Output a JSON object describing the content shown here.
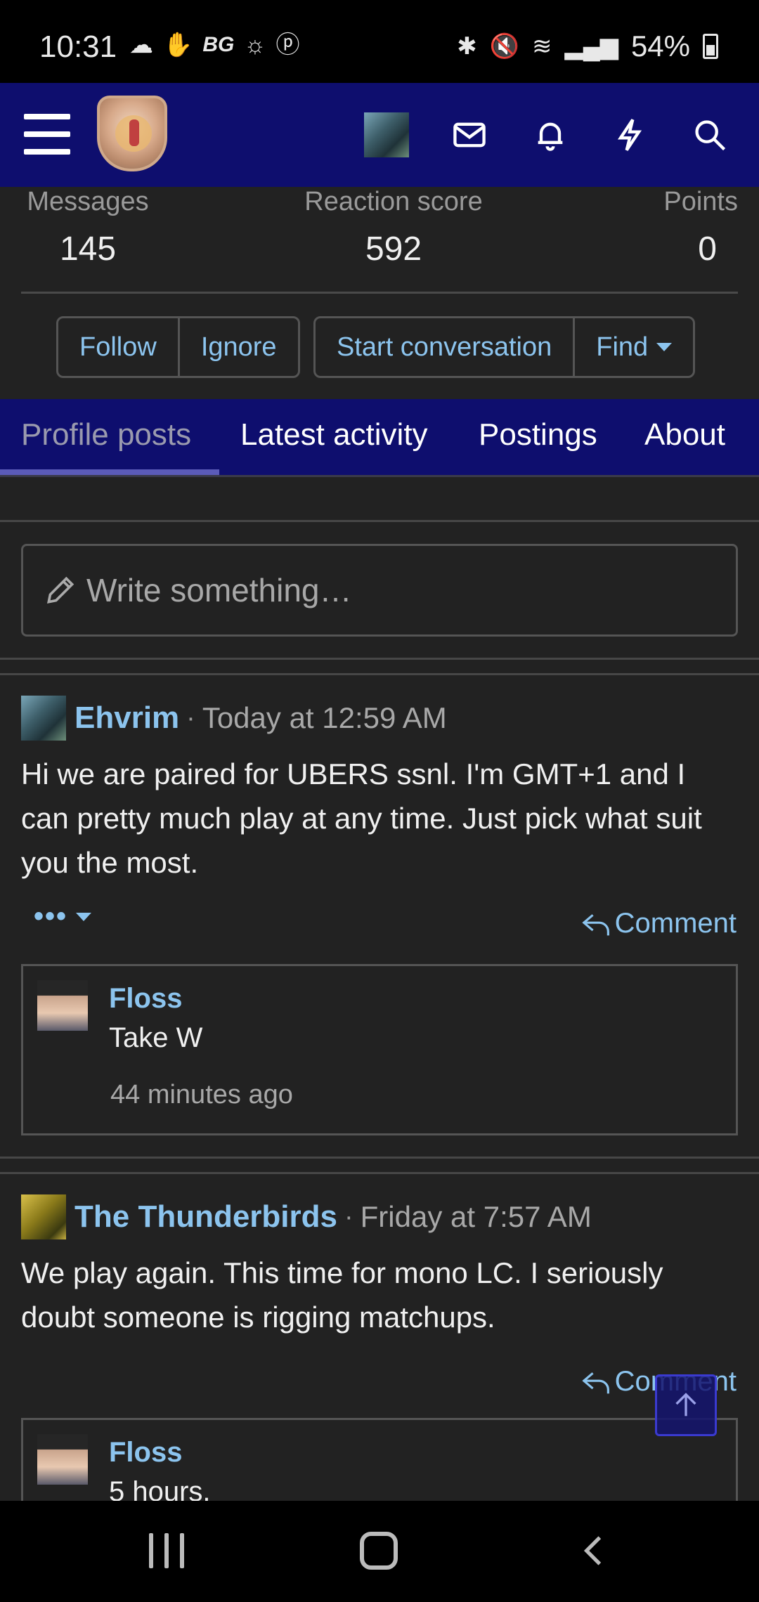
{
  "status_bar": {
    "time": "10:31",
    "left_icons": [
      "cloud-icon",
      "thumbs-icon",
      "bg-icon",
      "brightness-icon",
      "pi-icon"
    ],
    "bg_text": "BG",
    "battery_text": "54%",
    "right_icons": [
      "bluetooth-icon",
      "mute-icon",
      "wifi-icon",
      "signal-icon",
      "battery-icon"
    ]
  },
  "header": {
    "icons": [
      "menu-icon",
      "site-logo",
      "user-avatar",
      "mail-icon",
      "bell-icon",
      "bolt-icon",
      "search-icon"
    ]
  },
  "stats": [
    {
      "label": "Messages",
      "value": "145"
    },
    {
      "label": "Reaction score",
      "value": "592"
    },
    {
      "label": "Points",
      "value": "0"
    }
  ],
  "actions": {
    "follow": "Follow",
    "ignore": "Ignore",
    "start_conversation": "Start conversation",
    "find": "Find"
  },
  "tabs": [
    {
      "label": "Profile posts",
      "active": true
    },
    {
      "label": "Latest activity",
      "active": false
    },
    {
      "label": "Postings",
      "active": false
    },
    {
      "label": "About",
      "active": false
    }
  ],
  "composer": {
    "placeholder": "Write something…"
  },
  "posts": [
    {
      "author": "Ehvrim",
      "separator": "·",
      "time": "Today at 12:59 AM",
      "body": "Hi we are paired for UBERS ssnl. I'm GMT+1 and I can pretty much play at any time. Just pick what suit you the most.",
      "more_label": "•••",
      "comment_label": "Comment",
      "comment": {
        "author": "Floss",
        "text": "Take W",
        "time": "44 minutes ago"
      }
    },
    {
      "author": "The Thunderbirds",
      "separator": "·",
      "time": "Friday at 7:57 AM",
      "body": "We play again. This time for mono LC. I seriously doubt someone is rigging matchups.",
      "comment_label": "Comment",
      "comment": {
        "author": "Floss",
        "text": "5 hours."
      }
    }
  ],
  "colors": {
    "header_bg": "#0e0e6e",
    "link": "#8cc4ee",
    "page_bg": "#222222"
  }
}
